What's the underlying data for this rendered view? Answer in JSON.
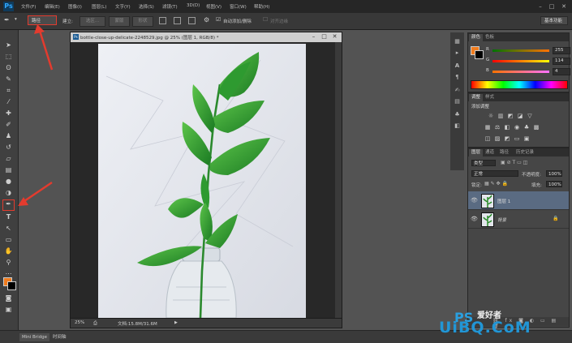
{
  "menubar": {
    "logo": "Ps",
    "items": [
      "文件(F)",
      "编辑(E)",
      "图像(I)",
      "图层(L)",
      "文字(Y)",
      "选择(S)",
      "滤镜(T)",
      "3D(D)",
      "视图(V)",
      "窗口(W)",
      "帮助(H)"
    ]
  },
  "options": {
    "mode": "路径",
    "make_label": "建立:",
    "selection_btn": "选区...",
    "mask_btn": "蒙版",
    "shape_btn": "形状",
    "auto_add_delete": "自动添加/删除",
    "align_edges": "对齐边缘",
    "workspace": "基本功能"
  },
  "document": {
    "title": "bottle-close-up-delicate-2248529.jpg @ 25% (图层 1, RGB/8) *",
    "zoom": "25%",
    "doc_info": "文档:15.8M/31.6M"
  },
  "color_panel": {
    "tabs": [
      "颜色",
      "色板"
    ],
    "r_label": "R",
    "g_label": "G",
    "b_label": "B",
    "r": "255",
    "g": "114",
    "b": "4",
    "fg": "#f07c1e",
    "bg": "#000000"
  },
  "adjust_panel": {
    "tabs": [
      "调整",
      "样式"
    ],
    "heading": "添加调整"
  },
  "layers_panel": {
    "tabs": [
      "图层",
      "通道",
      "路径",
      "历史记录"
    ],
    "kind": "类型",
    "blend": "正常",
    "opacity_label": "不透明度:",
    "opacity": "100%",
    "lock_label": "锁定:",
    "fill_label": "填充:",
    "fill": "100%",
    "layers": [
      {
        "name": "图层 1"
      },
      {
        "name": "背景"
      }
    ]
  },
  "bottom": {
    "tabs": [
      "Mini Bridge",
      "时间轴"
    ]
  },
  "watermark": {
    "ps": "PS",
    "cn": "爱好者",
    "site": "UiBQ.CoM"
  }
}
